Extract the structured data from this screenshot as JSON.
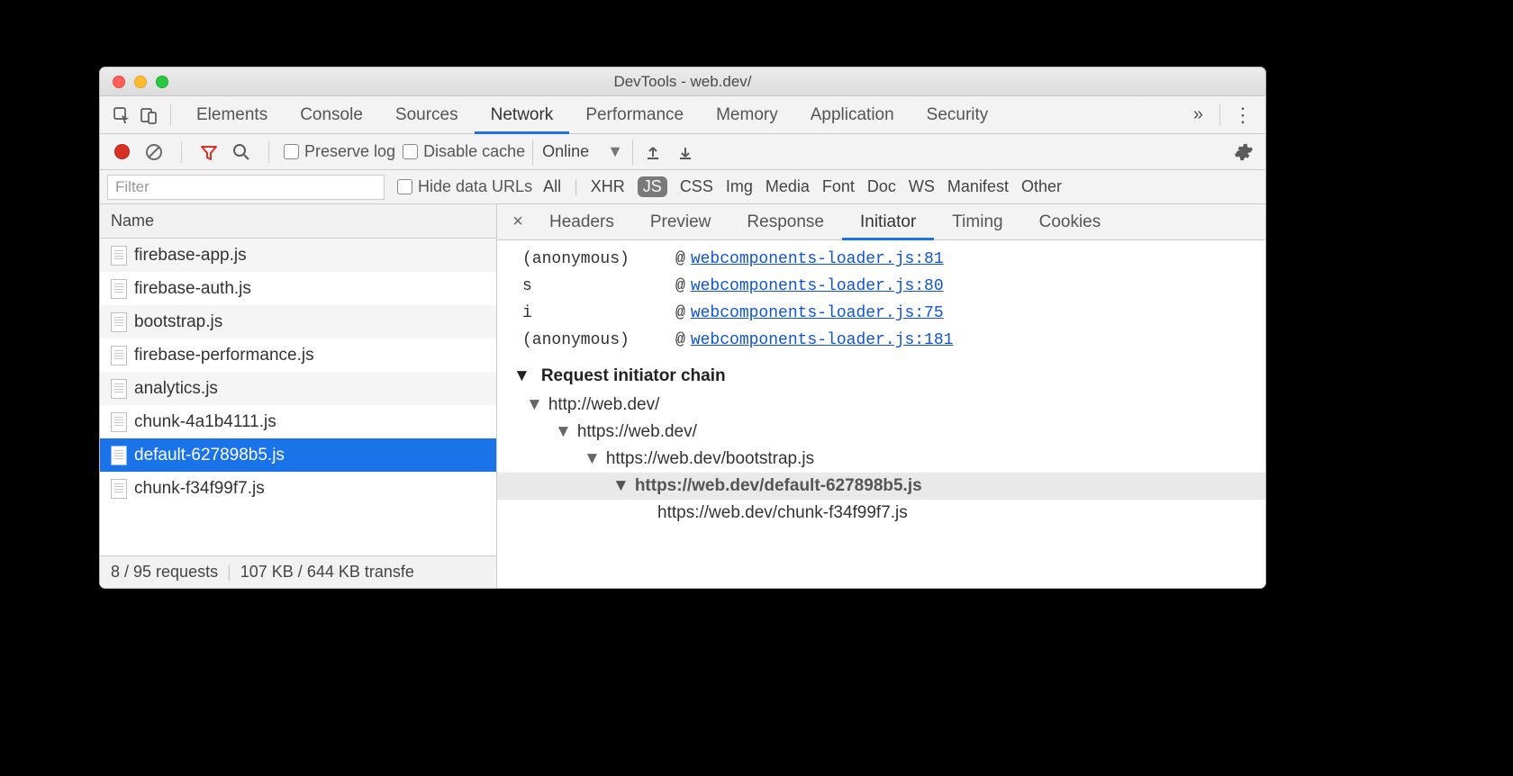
{
  "window": {
    "title": "DevTools - web.dev/"
  },
  "tabs": {
    "items": [
      "Elements",
      "Console",
      "Sources",
      "Network",
      "Performance",
      "Memory",
      "Application",
      "Security"
    ],
    "active": "Network",
    "overflow_glyph": "»"
  },
  "toolbar": {
    "preserve_log": "Preserve log",
    "disable_cache": "Disable cache",
    "throttling": "Online"
  },
  "filter": {
    "placeholder": "Filter",
    "hide_data_urls": "Hide data URLs",
    "types": [
      "All",
      "XHR",
      "JS",
      "CSS",
      "Img",
      "Media",
      "Font",
      "Doc",
      "WS",
      "Manifest",
      "Other"
    ],
    "selected_type": "JS"
  },
  "requests": {
    "header": "Name",
    "items": [
      {
        "name": "firebase-app.js",
        "selected": false
      },
      {
        "name": "firebase-auth.js",
        "selected": false
      },
      {
        "name": "bootstrap.js",
        "selected": false
      },
      {
        "name": "firebase-performance.js",
        "selected": false
      },
      {
        "name": "analytics.js",
        "selected": false
      },
      {
        "name": "chunk-4a1b4111.js",
        "selected": false
      },
      {
        "name": "default-627898b5.js",
        "selected": true
      },
      {
        "name": "chunk-f34f99f7.js",
        "selected": false
      }
    ],
    "status": {
      "count": "8 / 95 requests",
      "transfer": "107 KB / 644 KB transfe"
    }
  },
  "detail": {
    "tabs": [
      "Headers",
      "Preview",
      "Response",
      "Initiator",
      "Timing",
      "Cookies"
    ],
    "active_tab": "Initiator",
    "stack": [
      {
        "fn": "(anonymous)",
        "src": "webcomponents-loader.js:81"
      },
      {
        "fn": "s",
        "src": "webcomponents-loader.js:80"
      },
      {
        "fn": "i",
        "src": "webcomponents-loader.js:75"
      },
      {
        "fn": "(anonymous)",
        "src": "webcomponents-loader.js:181"
      }
    ],
    "chain_header": "Request initiator chain",
    "chain": [
      {
        "indent": 0,
        "url": "http://web.dev/",
        "arrow": true,
        "current": false
      },
      {
        "indent": 1,
        "url": "https://web.dev/",
        "arrow": true,
        "current": false
      },
      {
        "indent": 2,
        "url": "https://web.dev/bootstrap.js",
        "arrow": true,
        "current": false
      },
      {
        "indent": 3,
        "url": "https://web.dev/default-627898b5.js",
        "arrow": true,
        "current": true
      },
      {
        "indent": 4,
        "url": "https://web.dev/chunk-f34f99f7.js",
        "arrow": false,
        "current": false
      }
    ]
  }
}
